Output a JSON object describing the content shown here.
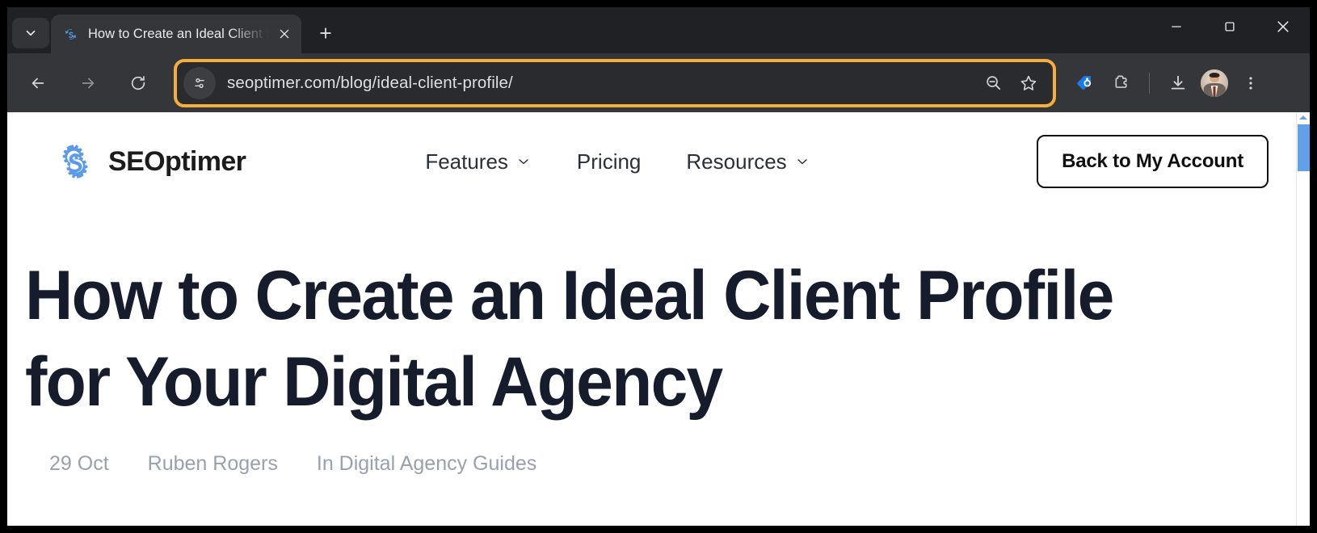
{
  "browser": {
    "tab_search_icon": "chevron-down-icon",
    "tab": {
      "favicon": "seoptimer-favicon",
      "title": "How to Create an Ideal Client Pr",
      "close_icon": "close-icon"
    },
    "new_tab_icon": "plus-icon",
    "window_controls": {
      "minimize_icon": "minimize-icon",
      "maximize_icon": "maximize-icon",
      "close_icon": "close-icon"
    },
    "nav": {
      "back_icon": "back-arrow-icon",
      "forward_icon": "forward-arrow-icon",
      "reload_icon": "reload-icon"
    },
    "omnibox": {
      "site_info_icon": "tune-sliders-icon",
      "url": "seoptimer.com/blog/ideal-client-profile/",
      "focus_ring_color": "#f5ad3c",
      "zoom_icon": "zoom-out-icon",
      "bookmark_icon": "star-icon"
    },
    "toolbar_right": {
      "tag_extension_icon": "blue-tag-icon",
      "extensions_icon": "puzzle-piece-icon",
      "downloads_icon": "download-icon",
      "profile_icon": "avatar",
      "menu_icon": "three-dot-menu-icon"
    }
  },
  "site": {
    "brand": {
      "logo_icon": "seoptimer-gear-logo",
      "name": "SEOptimer",
      "logo_color": "#5b9be8"
    },
    "nav_items": [
      {
        "label": "Features",
        "has_dropdown": true
      },
      {
        "label": "Pricing",
        "has_dropdown": false
      },
      {
        "label": "Resources",
        "has_dropdown": true
      }
    ],
    "account_button": "Back to My Account"
  },
  "article": {
    "title": "How to Create an Ideal Client Profile for Your Digital Agency",
    "meta": {
      "date": "29 Oct",
      "author": "Ruben Rogers",
      "category": "In Digital Agency Guides"
    }
  },
  "scrollbar": {
    "thumb_color": "#62a0e8",
    "arrow_icon": "scroll-up-arrow-icon"
  }
}
